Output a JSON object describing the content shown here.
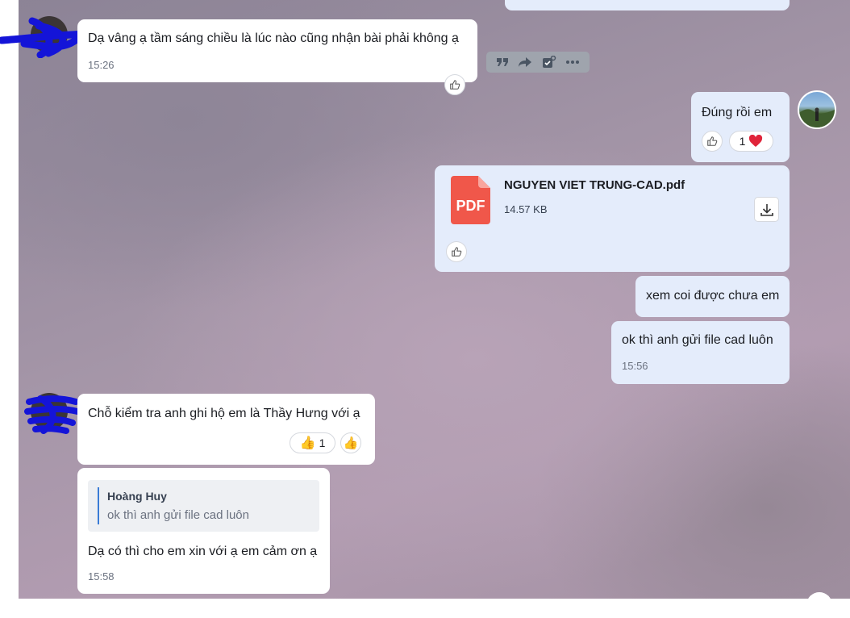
{
  "messages": [
    {
      "id": "m1",
      "side": "incoming",
      "text": "Dạ vâng ạ tầm sáng chiều là lúc nào cũng nhận bài phải không ạ",
      "time": "15:26"
    },
    {
      "id": "m2",
      "side": "outgoing",
      "text": "Đúng rồi em",
      "reactions": [
        {
          "icon": "heart-icon",
          "count": "1",
          "color": "#e0243a"
        }
      ]
    },
    {
      "id": "m3",
      "side": "outgoing",
      "type": "file",
      "file_icon_label": "PDF",
      "file_name": "NGUYEN VIET TRUNG-CAD.pdf",
      "file_size": "14.57 KB",
      "pdf_color": "#f0574a"
    },
    {
      "id": "m4",
      "side": "outgoing",
      "text": "xem coi được chưa em"
    },
    {
      "id": "m5",
      "side": "outgoing",
      "text": "ok thì anh gửi file cad luôn",
      "time": "15:56"
    },
    {
      "id": "m6",
      "side": "incoming",
      "text": "Chỗ kiểm tra anh ghi hộ em là Thầy Hưng với ạ",
      "reactions": [
        {
          "icon": "thumbs-up-emoji",
          "count": "1"
        }
      ]
    },
    {
      "id": "m7",
      "side": "incoming",
      "quote": {
        "author": "Hoàng Huy",
        "text": "ok thì anh gửi file cad luôn"
      },
      "text": "Dạ có thì cho em xin với ạ em cảm ơn ạ",
      "time": "15:58"
    }
  ],
  "hover_toolbar": [
    "quote-icon",
    "forward-icon",
    "task-icon",
    "more-icon"
  ],
  "colors": {
    "incoming_bubble": "#ffffff",
    "outgoing_bubble": "#e4ecfb",
    "quote_bar": "#3a7bd5",
    "redaction": "#1414d8"
  }
}
